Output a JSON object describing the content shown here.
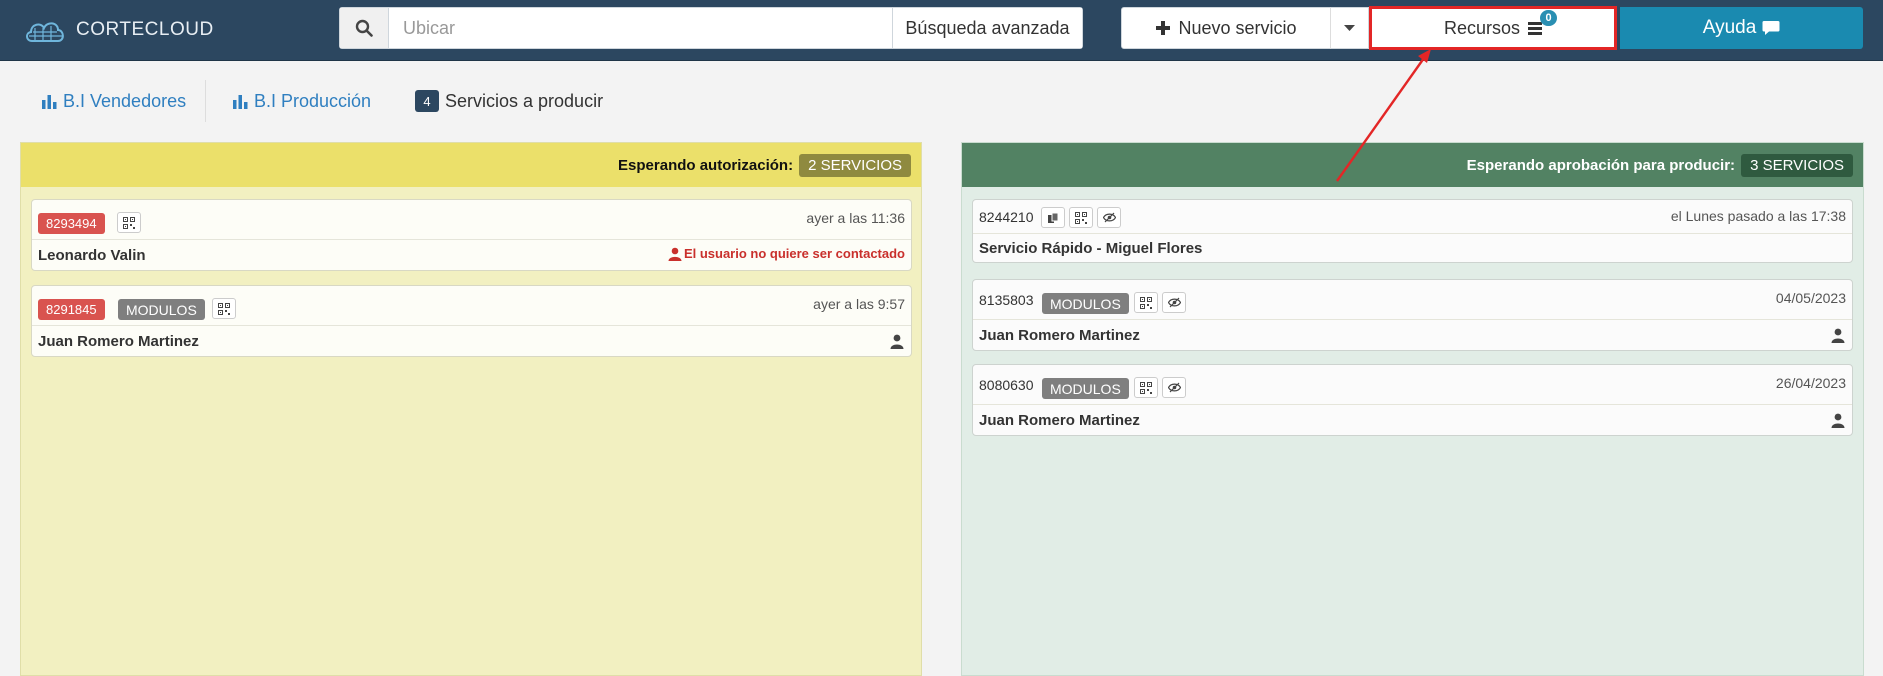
{
  "brand": {
    "name": "CORTECLOUD"
  },
  "search": {
    "placeholder": "Ubicar",
    "advanced_label": "Búsqueda avanzada"
  },
  "actions": {
    "new_service_label": "Nuevo servicio",
    "resources_label": "Recursos",
    "resources_badge": "0",
    "help_label": "Ayuda"
  },
  "nav": {
    "bi_sellers": "B.I Vendedores",
    "bi_production": "B.I Producción",
    "to_produce_count": "4",
    "to_produce_label": "Servicios a producir"
  },
  "columns": [
    {
      "title": "Esperando autorización:",
      "badge": "2 SERVICIOS",
      "cards": [
        {
          "id": "8293494",
          "tag": "",
          "time": "ayer a las 11:36",
          "name": "Leonardo Valin",
          "warning": "El usuario no quiere ser contactado"
        },
        {
          "id": "8291845",
          "tag": "MODULOS",
          "time": "ayer a las 9:57",
          "name": "Juan Romero Martinez",
          "warning": ""
        }
      ]
    },
    {
      "title": "Esperando aprobación para producir:",
      "badge": "3 SERVICIOS",
      "cards": [
        {
          "id": "8244210",
          "tag": "",
          "time": "el Lunes pasado a las 17:38",
          "name": "Servicio Rápido - Miguel Flores"
        },
        {
          "id": "8135803",
          "tag": "MODULOS",
          "time": "04/05/2023",
          "name": "Juan Romero Martinez"
        },
        {
          "id": "8080630",
          "tag": "MODULOS",
          "time": "26/04/2023",
          "name": "Juan Romero Martinez"
        }
      ]
    }
  ],
  "colors": {
    "topbar": "#2c4760",
    "help": "#1a8ab0",
    "highlight": "#e32626",
    "pending_auth": "#ebe06a",
    "pending_approval": "#528263",
    "id_badge": "#d9534f"
  }
}
